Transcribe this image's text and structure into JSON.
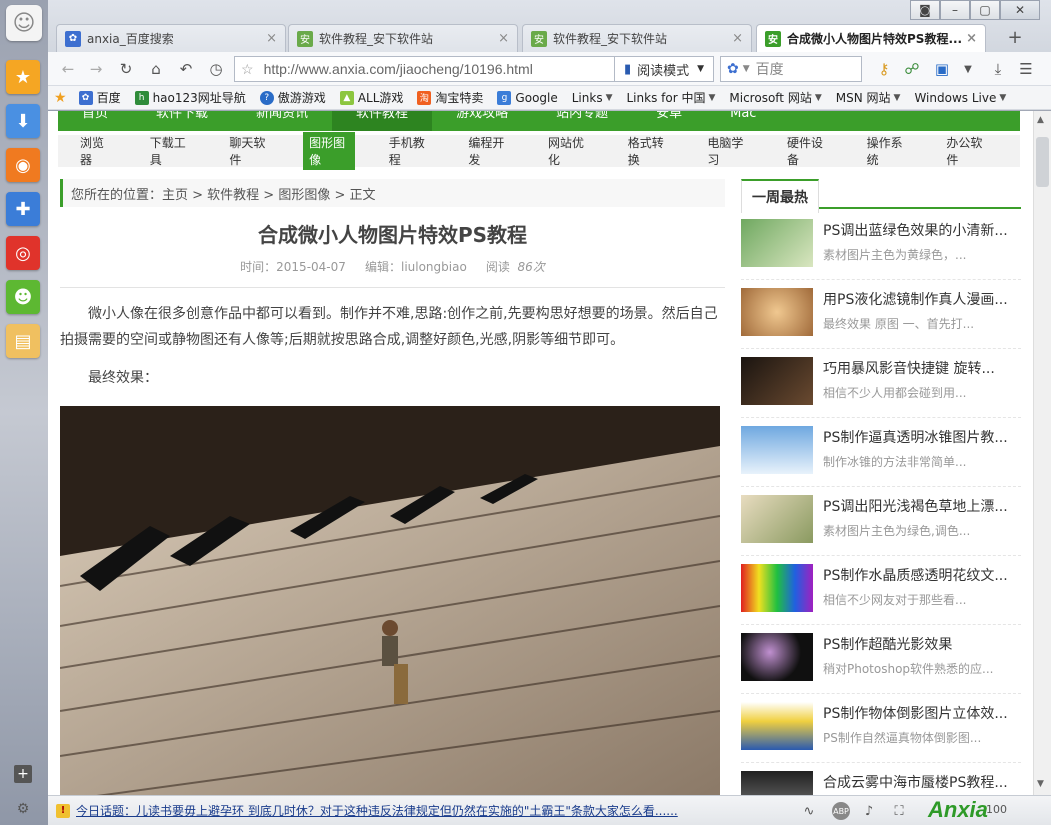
{
  "tabs": [
    {
      "label": "anxia_百度搜索",
      "icon": "baidu-paw-icon"
    },
    {
      "label": "软件教程_安下软件站",
      "icon": "anxia-site-icon"
    },
    {
      "label": "软件教程_安下软件站",
      "icon": "anxia-site-icon"
    },
    {
      "label": "合成微小人物图片特效PS教程...",
      "icon": "anxia-site-icon",
      "active": true
    }
  ],
  "address": {
    "url": "http://www.anxia.com/jiaocheng/10196.html",
    "read_mode": "阅读模式",
    "search_placeholder": "百度"
  },
  "bookmarks": [
    {
      "label": "百度"
    },
    {
      "label": "hao123网址导航"
    },
    {
      "label": "傲游游戏"
    },
    {
      "label": "ALL游戏"
    },
    {
      "label": "淘宝特卖"
    },
    {
      "label": "Google"
    },
    {
      "label": "Links",
      "dropdown": true
    },
    {
      "label": "Links for 中国",
      "dropdown": true
    },
    {
      "label": "Microsoft 网站",
      "dropdown": true
    },
    {
      "label": "MSN 网站",
      "dropdown": true
    },
    {
      "label": "Windows Live",
      "dropdown": true
    }
  ],
  "main_nav": [
    "首页",
    "软件下载",
    "新闻资讯",
    "软件教程",
    "游戏攻略",
    "站内专题",
    "安卓",
    "Mac"
  ],
  "sub_nav": [
    "浏览器",
    "下载工具",
    "聊天软件",
    "图形图像",
    "手机教程",
    "编程开发",
    "网站优化",
    "格式转换",
    "电脑学习",
    "硬件设备",
    "操作系统",
    "办公软件"
  ],
  "sub_nav_selected": "图形图像",
  "breadcrumb": "您所在的位置：主页 > 软件教程 > 图形图像 > 正文",
  "article": {
    "title": "合成微小人物图片特效PS教程",
    "time": "时间：2015-04-07",
    "editor": "编辑：liulongbiao",
    "read_label": "阅读",
    "views": "86次",
    "paragraph": "微小人像在很多创意作品中都可以看到。制作并不难,思路:创作之前,先要构思好想要的场景。然后自己拍摄需要的空间或静物图还有人像等;后期就按思路合成,调整好颜色,光感,阴影等细节即可。",
    "final_label": "最终效果："
  },
  "sidebar": {
    "heading": "一周最热",
    "items": [
      {
        "title": "PS调出蓝绿色效果的小清新...",
        "desc": "素材图片主色为黄绿色，..."
      },
      {
        "title": "用PS液化滤镜制作真人漫画...",
        "desc": "最终效果 原图 一、首先打..."
      },
      {
        "title": "巧用暴风影音快捷键 旋转...",
        "desc": "相信不少人用都会碰到用..."
      },
      {
        "title": "PS制作逼真透明冰锥图片教...",
        "desc": "制作冰锥的方法非常简单..."
      },
      {
        "title": "PS调出阳光浅褐色草地上漂...",
        "desc": "素材图片主色为绿色,调色..."
      },
      {
        "title": "PS制作水晶质感透明花纹文...",
        "desc": "相信不少网友对于那些看..."
      },
      {
        "title": "PS制作超酷光影效果",
        "desc": "稍对Photoshop软件熟悉的应..."
      },
      {
        "title": "PS制作物体倒影图片立体效...",
        "desc": "PS制作自然逼真物体倒影图..."
      },
      {
        "title": "合成云雾中海市蜃楼PS教程...",
        "desc": ""
      }
    ]
  },
  "statusbar": {
    "news": "今日话题：儿读书要毋上避孕环 到底几时休？对于这种违反法律规定但仍然在实施的\"土霸王\"条款大家怎么看......",
    "logo": "Anxia",
    "zoom": "100"
  },
  "colors": {
    "brand_green": "#3b9e2a"
  }
}
